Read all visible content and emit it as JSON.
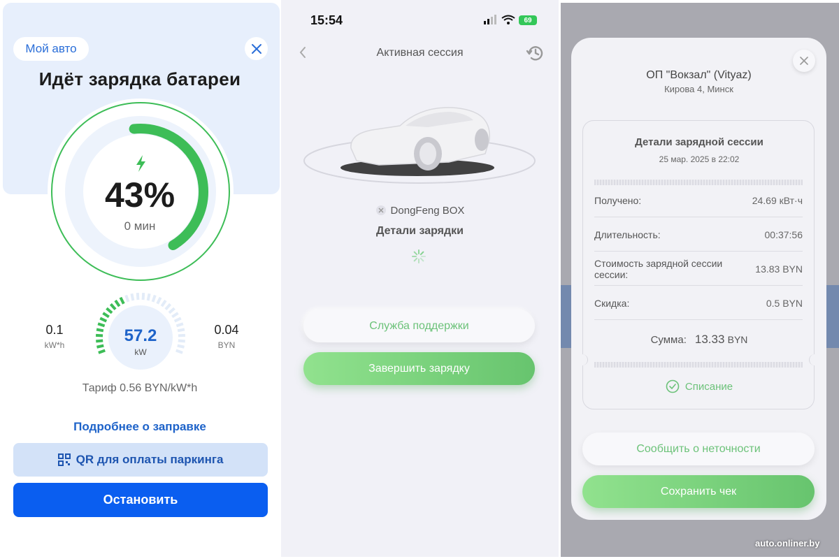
{
  "panel1": {
    "my_car": "Мой авто",
    "title": "Идёт зарядка батареи",
    "percent": "43%",
    "percent_value": 43,
    "time_left": "0 мин",
    "energy_value": "0.1",
    "energy_unit": "kW*h",
    "power_value": "57.2",
    "power_unit": "kW",
    "cost_value": "0.04",
    "cost_unit": "BYN",
    "tariff": "Тариф 0.56 BYN/kW*h",
    "more_link": "Подробнее о заправке",
    "qr_button": "QR для оплаты паркинга",
    "stop_button": "Остановить",
    "colors": {
      "accent": "#0a5ef0",
      "progress": "#3dbd57",
      "link": "#1e63c9"
    }
  },
  "panel2": {
    "status_time": "15:54",
    "battery": "69",
    "title": "Активная сессия",
    "car_name": "DongFeng BOX",
    "details_label": "Детали зарядки",
    "support_button": "Служба поддержки",
    "finish_button": "Завершить зарядку",
    "colors": {
      "green": "#6cc279"
    }
  },
  "panel3": {
    "station_name": "ОП \"Вокзал\" (Vityaz)",
    "station_address": "Кирова 4, Минск",
    "receipt_title": "Детали зарядной сессии",
    "receipt_date": "25 мар. 2025 в 22:02",
    "rows": [
      {
        "label": "Получено:",
        "value": "24.69 кВт·ч"
      },
      {
        "label": "Длительность:",
        "value": "00:37:56"
      },
      {
        "label": "Стоимость зарядной сессии сессии:",
        "value": "13.83 BYN"
      },
      {
        "label": "Скидка:",
        "value": "0.5 BYN"
      }
    ],
    "sum_label": "Сумма:",
    "sum_amount": "13.33",
    "sum_currency": "BYN",
    "paid_status": "Списание",
    "report_button": "Сообщить о неточности",
    "save_button": "Сохранить чек"
  },
  "watermark": "auto.onliner.by"
}
